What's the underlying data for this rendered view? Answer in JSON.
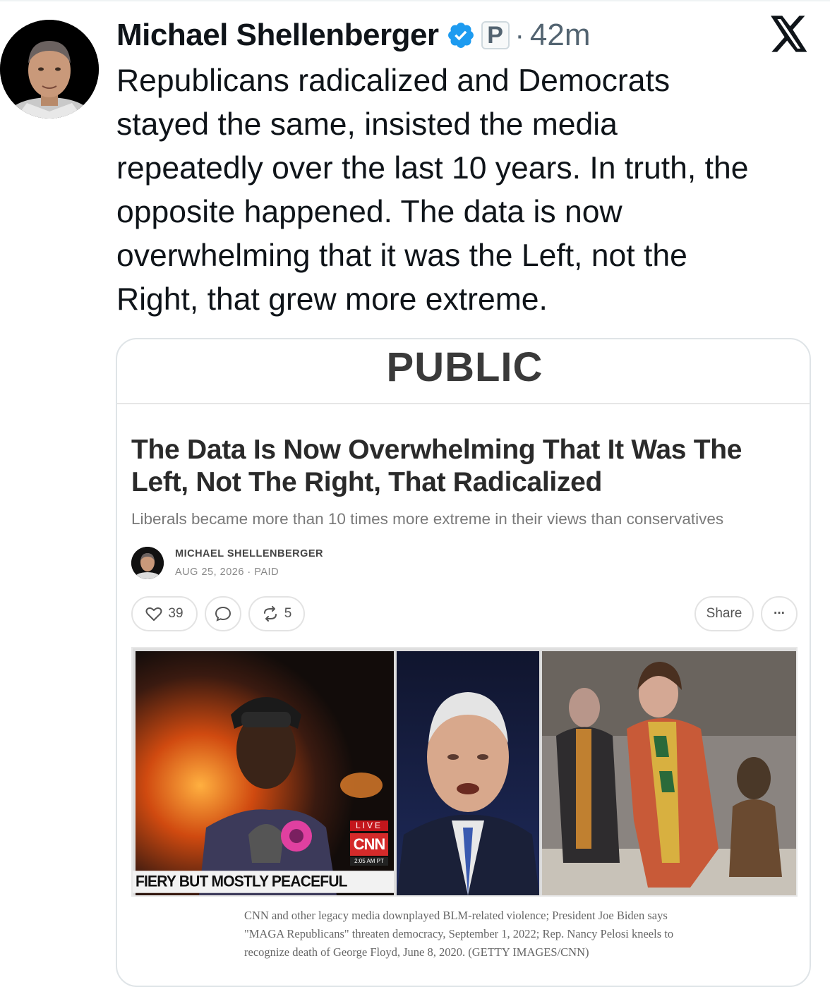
{
  "tweet": {
    "author_name": "Michael Shellenberger",
    "badge_letter": "P",
    "separator": "·",
    "time": "42m",
    "text": "Republicans radicalized and Democrats\nstayed the same, insisted the media\nrepeatedly over the last 10 years. In truth, the\nopposite happened. The data is now\noverwhelming that it was the Left, not the\nRight, that grew more extreme."
  },
  "card": {
    "publication": "PUBLIC",
    "article_title": "The Data Is Now Overwhelming That It Was The Left, Not The Right, That Radicalized",
    "article_subtitle": "Liberals became more than 10 times more extreme in their views than conservatives",
    "author": "MICHAEL SHELLENBERGER",
    "meta": "AUG 25, 2026 · PAID",
    "likes": "39",
    "restacks": "5",
    "share_label": "Share",
    "more_label": "···",
    "hero": {
      "live_label": "LIVE",
      "network_logo": "CNN",
      "network_time": "2:05 AM PT",
      "chyron": "FIERY BUT MOSTLY PEACEFUL PROTESTS"
    },
    "caption": "CNN and other legacy media downplayed BLM-related violence; President Joe Biden says \"MAGA Republicans\" threaten democracy, September 1, 2022; Rep. Nancy Pelosi kneels to recognize death of George Floyd, June 8, 2020. (GETTY IMAGES/CNN)"
  },
  "colors": {
    "verified_blue": "#1d9bf0",
    "text_primary": "#0f1419",
    "text_secondary": "#536471",
    "cnn_red": "#d42a2a"
  },
  "icons": [
    "verified-icon",
    "x-logo-icon",
    "heart-icon",
    "comment-icon",
    "restack-icon"
  ]
}
